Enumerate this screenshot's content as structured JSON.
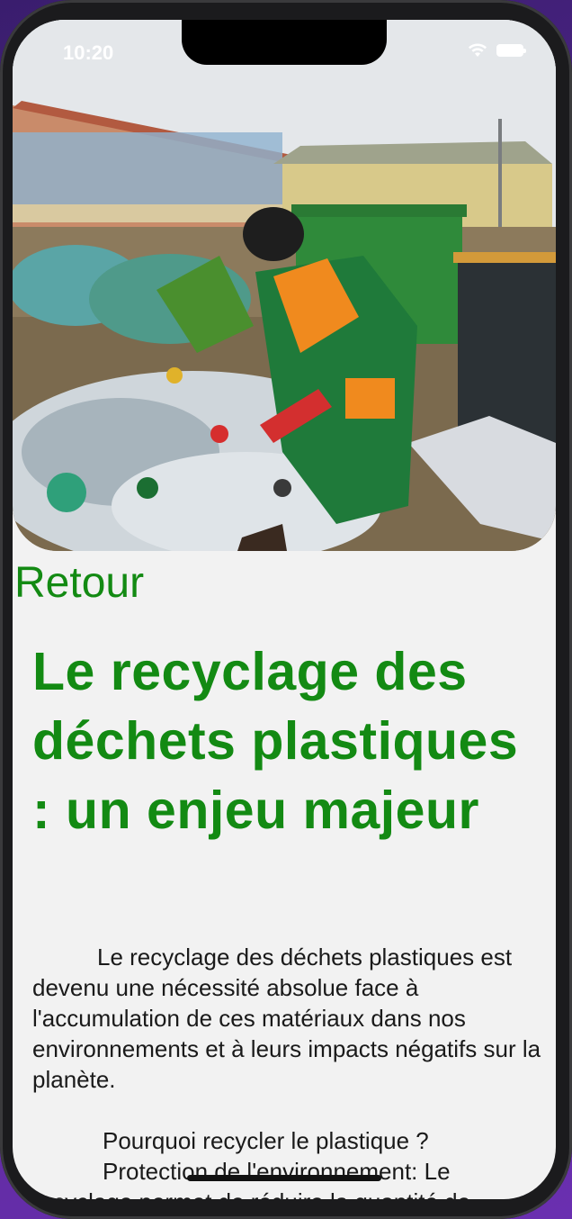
{
  "status_bar": {
    "time": "10:20"
  },
  "hero_image": {
    "alt": "Agente de recyclage triant des bouteilles en plastique"
  },
  "nav": {
    "back_label": "Retour"
  },
  "article": {
    "title": "Le recyclage des déchets plastiques : un enjeu majeur",
    "intro": "Le recyclage des déchets plastiques est devenu une nécessité absolue face à l'accumulation de ces matériaux dans nos environnements et à leurs impacts négatifs sur la planète.",
    "question": "Pourquoi recycler le plastique ?",
    "point_1": "Protection de l'environnement: Le recyclage permet de réduire la quantité de"
  },
  "colors": {
    "accent": "#138a13",
    "background": "#f2f2f2",
    "text": "#1a1a1a"
  }
}
